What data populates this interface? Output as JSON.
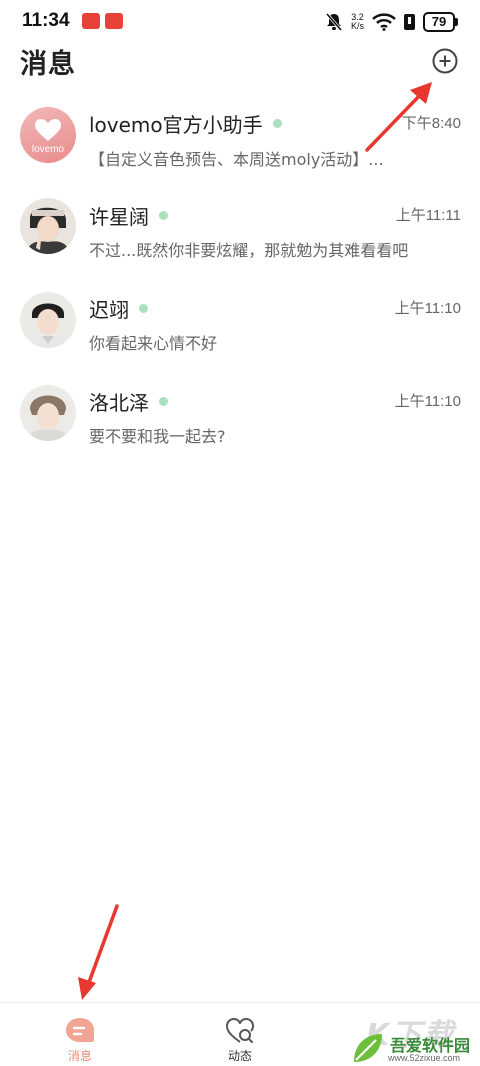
{
  "status_bar": {
    "time": "11:34",
    "net_speed_value": "3.2",
    "net_speed_unit": "K/s",
    "battery": "79",
    "icons": [
      "app-badge",
      "app-badge",
      "bell-muted-icon",
      "wifi-icon",
      "sim-icon",
      "battery-icon"
    ]
  },
  "header": {
    "title": "消息",
    "add_icon": "plus-circle-icon"
  },
  "conversations": [
    {
      "name": "lovemo官方小助手",
      "time": "下午8:40",
      "preview": "【自定义音色预告、本周送moly活动】...",
      "online": true,
      "avatar_text": "lovemo"
    },
    {
      "name": "许星阔",
      "time": "上午11:11",
      "preview": "不过...既然你非要炫耀，那就勉为其难看看吧",
      "online": true
    },
    {
      "name": "迟翊",
      "time": "上午11:10",
      "preview": "你看起来心情不好",
      "online": true
    },
    {
      "name": "洛北泽",
      "time": "上午11:10",
      "preview": "要不要和我一起去?",
      "online": true
    }
  ],
  "bottom_nav": {
    "tabs": [
      {
        "label": "消息",
        "icon": "chat-bubble-icon",
        "active": true
      },
      {
        "label": "动态",
        "icon": "heart-search-icon",
        "active": false
      }
    ]
  },
  "watermark": {
    "big": "K下载",
    "title": "吾爱软件园",
    "url": "www.52zixue.com"
  },
  "colors": {
    "accent": "#e98a78",
    "online_dot": "#a8e0bf",
    "arrow": "#e8372f"
  }
}
